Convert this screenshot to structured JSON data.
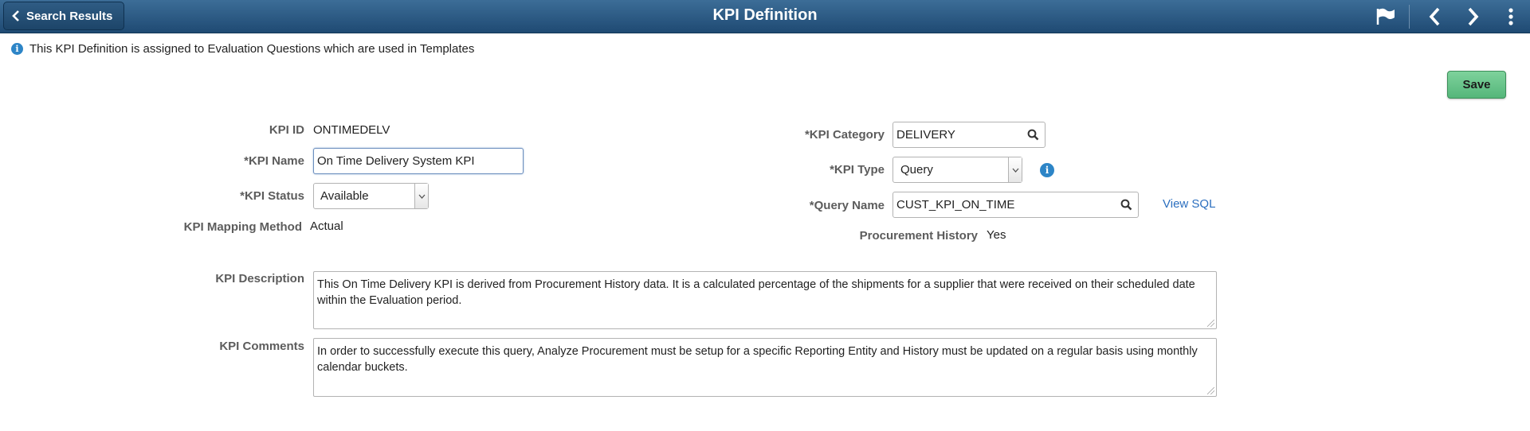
{
  "header": {
    "back_label": "Search Results",
    "title": "KPI Definition",
    "icons": [
      "flag-icon",
      "chevron-left-icon",
      "chevron-right-icon",
      "more-vertical-icon"
    ]
  },
  "info_message": "This KPI Definition is assigned to Evaluation Questions which are used in Templates",
  "save_label": "Save",
  "form": {
    "kpi_id": {
      "label": "KPI ID",
      "value": "ONTIMEDELV"
    },
    "kpi_name": {
      "label": "*KPI Name",
      "value": "On Time Delivery System KPI"
    },
    "kpi_status": {
      "label": "*KPI Status",
      "value": "Available"
    },
    "kpi_mapping_method": {
      "label": "KPI Mapping Method",
      "value": "Actual"
    },
    "kpi_category": {
      "label": "*KPI Category",
      "value": "DELIVERY"
    },
    "kpi_type": {
      "label": "*KPI Type",
      "value": "Query"
    },
    "query_name": {
      "label": "*Query Name",
      "value": "CUST_KPI_ON_TIME"
    },
    "view_sql": "View SQL",
    "procurement_history": {
      "label": "Procurement History",
      "value": "Yes"
    },
    "kpi_description": {
      "label": "KPI Description",
      "value": "This On Time Delivery KPI is derived from Procurement History data.  It is a calculated percentage of the shipments for a supplier that were  received on their scheduled date within the Evaluation period."
    },
    "kpi_comments": {
      "label": "KPI Comments",
      "value": "In order to successfully execute this query, Analyze Procurement must be setup for a specific Reporting Entity and History must be updated on a regular basis using monthly calendar buckets."
    }
  },
  "colors": {
    "header_top": "#3c6d97",
    "header_bottom": "#1f4a73",
    "save_button": "#6cc58d",
    "link": "#2c6fbf",
    "info_icon": "#2d85c7"
  }
}
